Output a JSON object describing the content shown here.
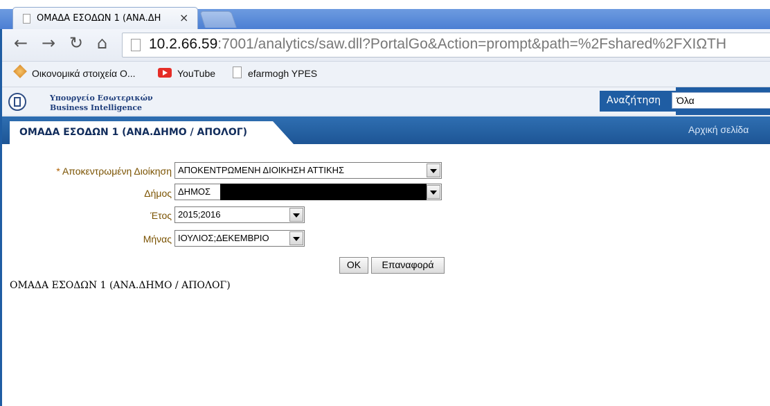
{
  "browser": {
    "tab_title": "ΟΜΑΔΑ ΕΣΟΔΩΝ 1 (ΑΝΑ.ΔΗ",
    "tab_close": "×",
    "url_host": "10.2.66.59",
    "url_rest": ":7001/analytics/saw.dll?PortalGo&Action=prompt&path=%2Fshared%2FXIΩΤH",
    "bookmarks": [
      {
        "label": "Οικονομικά στοιχεία Ο..."
      },
      {
        "label": "YouTube"
      },
      {
        "label": "efarmogh YPES"
      }
    ]
  },
  "app": {
    "ministry": "Υπουργείο Εσωτερικών",
    "product": "Business Intelligence",
    "search_label": "Αναζήτηση",
    "search_scope": "Όλα",
    "dashboard_title": "ΟΜΑΔΑ ΕΣΟΔΩΝ 1 (ΑΝΑ.ΔΗΜΟ / ΑΠΟΛΟΓ)",
    "home_link": "Αρχική σελίδα"
  },
  "prompts": {
    "required_marker": "*",
    "fields": [
      {
        "label": "Αποκεντρωμένη Διοίκηση",
        "value": "ΑΠΟΚΕΝΤΡΩΜΕΝΗ ΔΙΟΙΚΗΣΗ ΑΤΤΙΚΗΣ"
      },
      {
        "label": "Δήμος",
        "value": "ΔΗΜΟΣ"
      },
      {
        "label": "Έτος",
        "value": "2015;2016"
      },
      {
        "label": "Μήνας",
        "value": "ΙΟΥΛΙΟΣ;ΔΕΚΕΜΒΡΙΟ"
      }
    ],
    "ok_label": "OK",
    "reset_label": "Επαναφορά"
  },
  "report": {
    "title": "ΟΜΑΔΑ ΕΣΟΔΩΝ 1 (ΑΝΑ.ΔΗΜΟ / ΑΠΟΛΟΓ)"
  },
  "colors": {
    "accent_blue": "#1f5da3",
    "label_brown": "#7a5200"
  }
}
